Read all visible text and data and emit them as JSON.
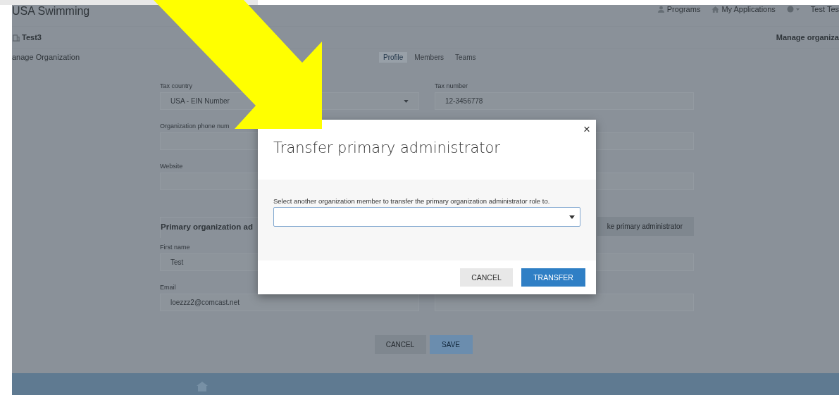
{
  "app": {
    "title": "USA Swimming",
    "nav": [
      {
        "label": "Programs"
      },
      {
        "label": "My Applications"
      }
    ],
    "user": "Test Tes"
  },
  "org": {
    "name": "Test3",
    "breadcrumb": "Manage organiza"
  },
  "subnav": {
    "title": "anage Organization",
    "tabs": [
      {
        "label": "Profile",
        "selected": true
      },
      {
        "label": "Members",
        "selected": false
      },
      {
        "label": "Teams",
        "selected": false
      }
    ]
  },
  "form": {
    "rows": [
      {
        "left": {
          "label": "Tax country",
          "value": "USA - EIN Number",
          "kind": "select"
        },
        "right": {
          "label": "Tax number",
          "value": "12-3456778"
        }
      },
      {
        "left": {
          "label": "Organization phone num"
        },
        "right": {}
      },
      {
        "left": {
          "label": "Website"
        },
        "right": {}
      }
    ],
    "admin_section": {
      "title": "Primary organization ad",
      "button": "ke primary administrator"
    },
    "admin_rows": [
      {
        "left": {
          "label": "First name",
          "value": "Test"
        },
        "right": {}
      },
      {
        "left": {
          "label": "Email",
          "value": "loezzz2@comcast.net"
        },
        "right": {}
      }
    ],
    "actions": [
      {
        "label": "CANCEL",
        "kind": "secondary"
      },
      {
        "label": "SAVE",
        "kind": "primary"
      }
    ]
  },
  "modal": {
    "title": "Transfer primary administrator",
    "close": "×",
    "message": "Select another organization member to transfer the primary organization administrator role to.",
    "buttons": [
      {
        "label": "CANCEL",
        "kind": "secondary"
      },
      {
        "label": "TRANSFER",
        "kind": "primary"
      }
    ]
  }
}
